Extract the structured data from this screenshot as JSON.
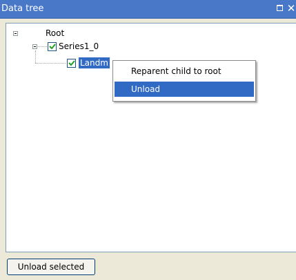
{
  "window": {
    "title": "Data tree",
    "restore_icon": "restore-icon",
    "close_icon": "close-icon"
  },
  "tree": {
    "root": {
      "label": "Root",
      "expanded": true
    },
    "series": {
      "label": "Series1_0",
      "checked": true,
      "expanded": true
    },
    "landmark": {
      "label": "Landm",
      "checked": true,
      "selected": true
    }
  },
  "context_menu": {
    "items": [
      {
        "label": "Reparent child to root",
        "highlighted": false
      },
      {
        "label": "Unload",
        "highlighted": true
      }
    ]
  },
  "footer": {
    "unload_selected_label": "Unload selected"
  },
  "colors": {
    "titlebar": "#4a78c9",
    "selection": "#316ac5",
    "panel_bg": "#ece9d8"
  }
}
